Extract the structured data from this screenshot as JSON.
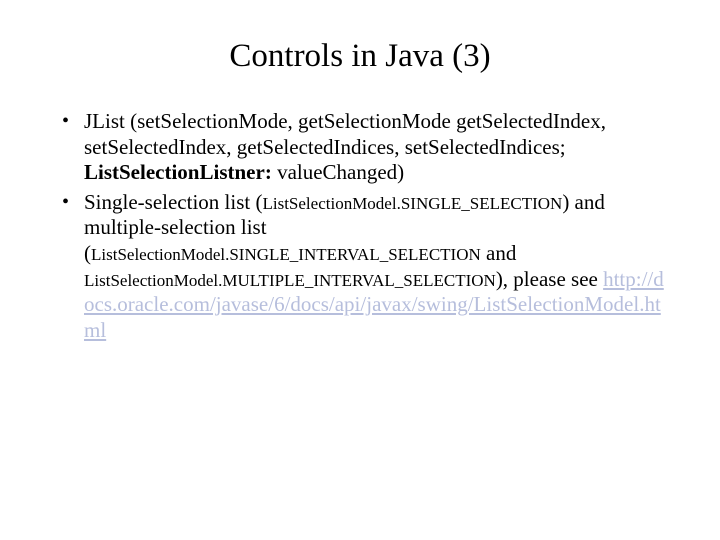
{
  "title": "Controls in Java (3)",
  "bullets": [
    {
      "segments": [
        {
          "text": "JList (setSelectionMode, getSelectionMode getSelectedIndex, setSelectedIndex, getSelectedIndices, setSelectedIndices; "
        },
        {
          "text": "ListSelectionListner:",
          "bold": true
        },
        {
          "text": " valueChanged)"
        }
      ]
    },
    {
      "segments": [
        {
          "text": "Single-selection list ("
        },
        {
          "text": "ListSelectionModel.SINGLE_SELECTION",
          "small": true
        },
        {
          "text": ") and multiple-selection list ("
        },
        {
          "text": "ListSelectionModel.SINGLE_INTERVAL_SELECTION",
          "small": true
        },
        {
          "text": " and "
        },
        {
          "text": "ListSelectionModel.MULTIPLE_INTERVAL_SELECTION",
          "small": true
        },
        {
          "text": "), please see "
        },
        {
          "text": "http://docs.oracle.com/javase/6/docs/api/javax/swing/ListSelectionModel.html",
          "link": true
        }
      ]
    }
  ]
}
